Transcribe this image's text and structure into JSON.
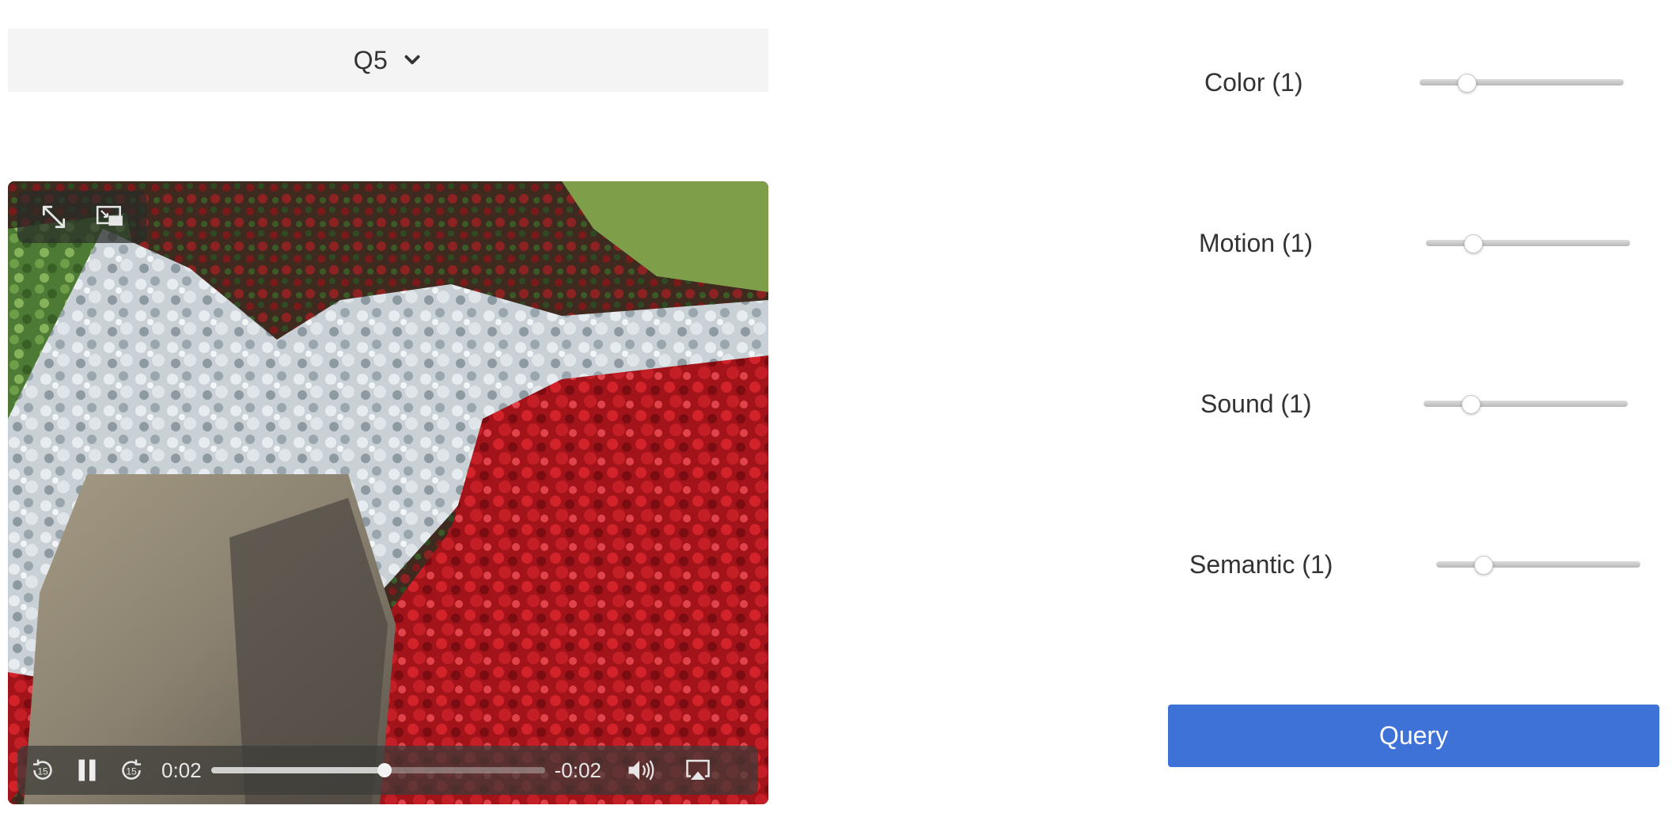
{
  "dropdown": {
    "selected": "Q5",
    "icon": "chevron-down-icon"
  },
  "video": {
    "top_controls": {
      "fullscreen_icon": "expand-icon",
      "pip_icon": "picture-in-picture-icon"
    },
    "controls": {
      "skip_back_icon": "rewind-15-icon",
      "skip_back_label": "15",
      "play_pause_icon": "pause-icon",
      "skip_forward_icon": "forward-15-icon",
      "skip_forward_label": "15",
      "elapsed": "0:02",
      "remaining": "-0:02",
      "progress_fraction": 0.52,
      "volume_icon": "speaker-volume-icon",
      "airplay_icon": "airplay-icon"
    }
  },
  "sliders": [
    {
      "id": "color",
      "label": "Color (1)",
      "value_fraction": 0.23
    },
    {
      "id": "motion",
      "label": "Motion (1)",
      "value_fraction": 0.23
    },
    {
      "id": "sound",
      "label": "Sound (1)",
      "value_fraction": 0.23
    },
    {
      "id": "semantic",
      "label": "Semantic (1)",
      "value_fraction": 0.23
    }
  ],
  "query_button": {
    "label": "Query",
    "color": "#3f72d7"
  }
}
